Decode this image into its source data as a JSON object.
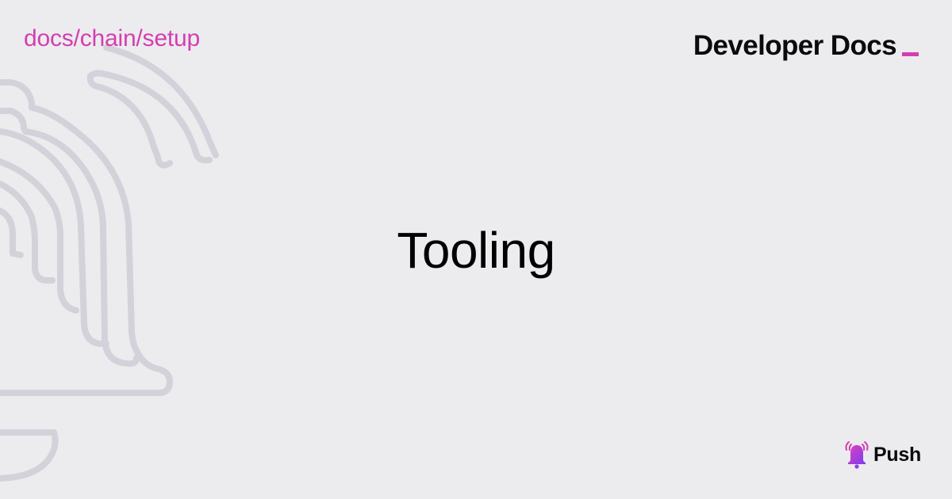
{
  "header": {
    "breadcrumb": "docs/chain/setup",
    "brand_title": "Developer Docs"
  },
  "main": {
    "title": "Tooling"
  },
  "footer": {
    "logo_text": "Push",
    "logo_icon": "bell-icon"
  },
  "colors": {
    "background": "#ECECEE",
    "accent": "#D43EB0",
    "text": "#0B0B0E",
    "decoration": "#D3D2DA"
  }
}
